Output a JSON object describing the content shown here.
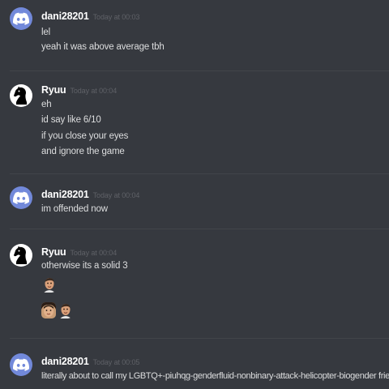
{
  "messages": [
    {
      "username": "dani28201",
      "timestamp": "Today at 00:03",
      "lines": [
        "lel",
        "yeah it was above average tbh"
      ]
    },
    {
      "username": "Ryuu",
      "timestamp": "Today at 00:04",
      "lines": [
        "eh",
        "id say like 6/10",
        "if you close your eyes",
        "and ignore the game"
      ]
    },
    {
      "username": "dani28201",
      "timestamp": "Today at 00:04",
      "lines": [
        "im offended now"
      ]
    },
    {
      "username": "Ryuu",
      "timestamp": "Today at 00:04",
      "lines": [
        "otherwise its a solid 3"
      ]
    },
    {
      "username": "dani28201",
      "timestamp": "Today at 00:05",
      "lines": [
        "literally about to call my LGBTQ+-piuhqg-genderfluid-nonbinary-attack-helicopter-biogender friends"
      ]
    }
  ],
  "colors": {
    "background": "#36393f",
    "discord_blurple": "#7289da",
    "username": "#ffffff",
    "message_text": "#dcddde",
    "timestamp": "#5f6167"
  },
  "icons": {
    "default_avatar": "discord-logo-icon",
    "ryuu_avatar": "knight-chess-piece-icon",
    "custom_emoji": "face-emoji-icon"
  }
}
